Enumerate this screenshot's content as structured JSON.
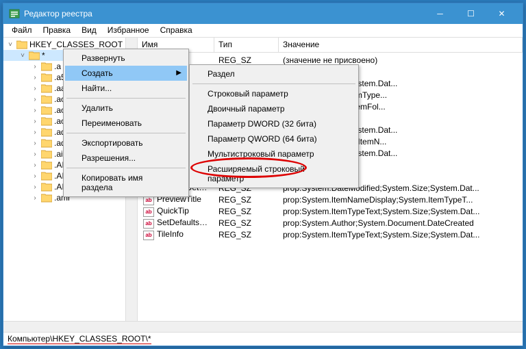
{
  "title": "Редактор реестра",
  "menubar": [
    "Файл",
    "Правка",
    "Вид",
    "Избранное",
    "Справка"
  ],
  "tree": {
    "root": "HKEY_CLASSES_ROOT",
    "items": [
      "*",
      ".a",
      ".a52",
      ".aac",
      ".ac3",
      ".accountpicture-ms",
      ".ace",
      ".adt",
      ".adts",
      ".ai",
      ".AIF",
      ".AIFC",
      ".AIFF",
      ".amr"
    ]
  },
  "list": {
    "headers": [
      "Имя",
      "Тип",
      "Значение"
    ],
    "rows": [
      {
        "name": "нию)",
        "type": "REG_SZ",
        "val": "(значение не присвоено)"
      },
      {
        "name": "",
        "type": "REG_SZ",
        "val": ""
      },
      {
        "name": "",
        "type": "REG_SZ",
        "val": "Text;System.Size;System.Dat..."
      },
      {
        "name": "",
        "type": "REG_SZ",
        "val": "eDisplay;System.ItemType..."
      },
      {
        "name": "",
        "type": "REG_SZ",
        "val": "eDisplay;~System.ItemFol..."
      },
      {
        "name": "",
        "type": "",
        "val": ""
      },
      {
        "name": "cs",
        "type": "REG_SZ",
        "val": "Text;System.Size;System.Dat..."
      },
      {
        "name": "",
        "type": "REG_SZ",
        "val": ".FileSystem;System.ItemN..."
      },
      {
        "name": "",
        "type": "REG_SZ",
        "val": "Text;System.Size;System.Dat..."
      },
      {
        "name": "",
        "type": "REG_SZ",
        "val": ""
      },
      {
        "name": "NoStaticDefault...",
        "type": "REG_SZ",
        "val": ""
      },
      {
        "name": "PreviewDetails",
        "type": "REG_SZ",
        "val": "prop:System.DateModified;System.Size;System.Dat..."
      },
      {
        "name": "PreviewTitle",
        "type": "REG_SZ",
        "val": "prop:System.ItemNameDisplay;System.ItemTypeT..."
      },
      {
        "name": "QuickTip",
        "type": "REG_SZ",
        "val": "prop:System.ItemTypeText;System.Size;System.Dat..."
      },
      {
        "name": "SetDefaultsFor",
        "type": "REG_SZ",
        "val": "prop:System.Author;System.Document.DateCreated"
      },
      {
        "name": "TileInfo",
        "type": "REG_SZ",
        "val": "prop:System.ItemTypeText;System.Size;System.Dat..."
      }
    ]
  },
  "ctx1": {
    "items": [
      "Развернуть",
      "Создать",
      "Найти..."
    ],
    "items2": [
      "Удалить",
      "Переименовать"
    ],
    "items3": [
      "Экспортировать",
      "Разрешения..."
    ],
    "items4": [
      "Копировать имя раздела"
    ]
  },
  "ctx2": {
    "items": [
      "Раздел"
    ],
    "items2": [
      "Строковый параметр",
      "Двоичный параметр",
      "Параметр DWORD (32 бита)",
      "Параметр QWORD (64 бита)",
      "Мультистроковый параметр",
      "Расширяемый строковый параметр"
    ]
  },
  "status": "Компьютер\\HKEY_CLASSES_ROOT\\*"
}
